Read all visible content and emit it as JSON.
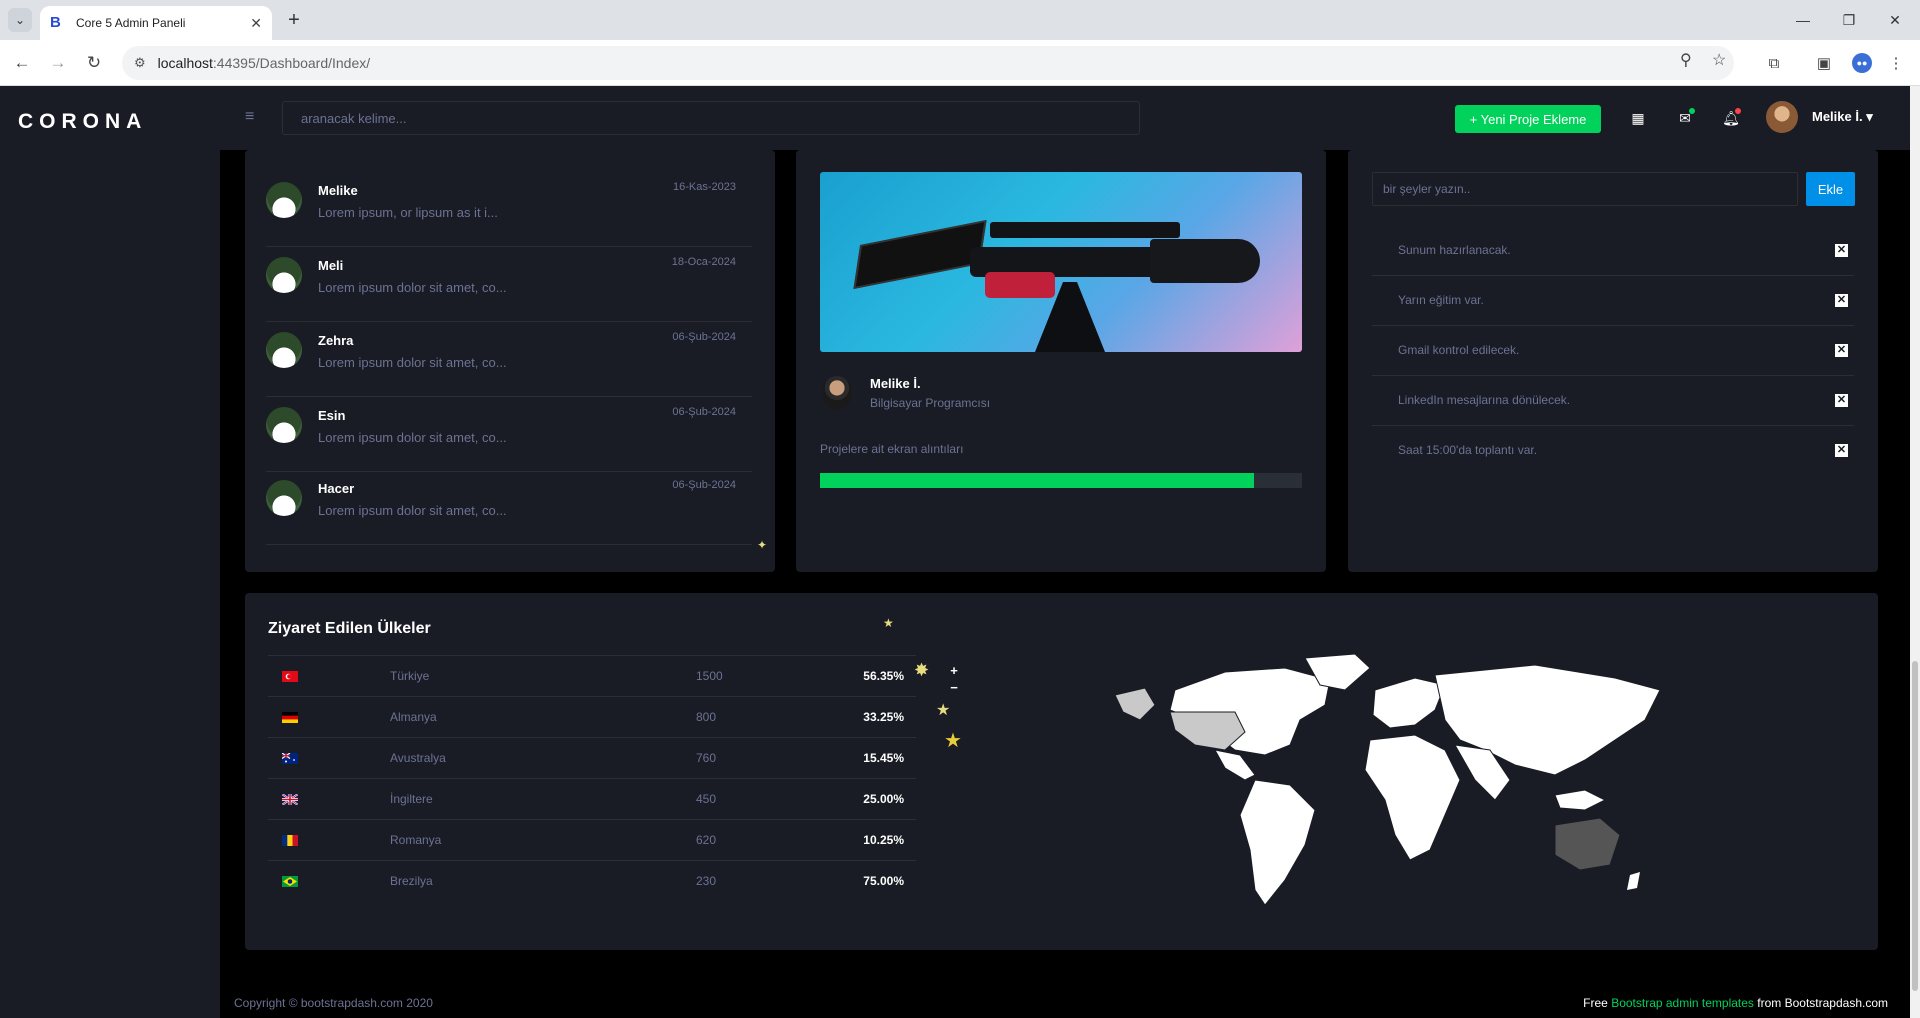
{
  "browser": {
    "tab_title": "Core 5 Admin Paneli",
    "tab_favicon": "B",
    "url_host": "localhost",
    "url_path": ":44395/Dashboard/Index/"
  },
  "app": {
    "brand": "CORONA",
    "search_placeholder": "aranacak kelime...",
    "new_project_label": "+ Yeni Proje Ekleme",
    "user_name": "Melike İ."
  },
  "messages": [
    {
      "name": "Melike",
      "text": "Lorem ipsum, or lipsum as it i...",
      "date": "16-Kas-2023"
    },
    {
      "name": "Meli",
      "text": "Lorem ipsum dolor sit amet, co...",
      "date": "18-Oca-2024"
    },
    {
      "name": "Zehra",
      "text": "Lorem ipsum dolor sit amet, co...",
      "date": "06-Şub-2024"
    },
    {
      "name": "Esin",
      "text": "Lorem ipsum dolor sit amet, co...",
      "date": "06-Şub-2024"
    },
    {
      "name": "Hacer",
      "text": "Lorem ipsum dolor sit amet, co...",
      "date": "06-Şub-2024"
    }
  ],
  "project": {
    "owner_name": "Melike İ.",
    "owner_role": "Bilgisayar Programcısı",
    "description": "Projelere ait ekran alıntıları",
    "progress": 0.9
  },
  "todo": {
    "placeholder": "bir şeyler yazın..",
    "add_label": "Ekle",
    "items": [
      "Sunum hazırlanacak.",
      "Yarın eğitim var.",
      "Gmail kontrol edilecek.",
      "LinkedIn mesajlarına dönülecek.",
      "Saat 15:00'da toplantı var."
    ]
  },
  "visited": {
    "title": "Ziyaret Edilen Ülkeler",
    "rows": [
      {
        "country": "Türkiye",
        "value": "1500",
        "percent": "56.35%",
        "flag": "tr"
      },
      {
        "country": "Almanya",
        "value": "800",
        "percent": "33.25%",
        "flag": "de"
      },
      {
        "country": "Avustralya",
        "value": "760",
        "percent": "15.45%",
        "flag": "au"
      },
      {
        "country": "İngiltere",
        "value": "450",
        "percent": "25.00%",
        "flag": "gb"
      },
      {
        "country": "Romanya",
        "value": "620",
        "percent": "10.25%",
        "flag": "ro"
      },
      {
        "country": "Brezilya",
        "value": "230",
        "percent": "75.00%",
        "flag": "br"
      }
    ],
    "zoom_in": "+",
    "zoom_out": "−"
  },
  "footer": {
    "copyright": "Copyright © bootstrapdash.com 2020",
    "free": "Free ",
    "link": "Bootstrap admin templates",
    "from": " from Bootstrapdash.com"
  },
  "colors": {
    "accent_green": "#00d25b",
    "accent_blue": "#0090e7",
    "panel": "#191c24"
  }
}
